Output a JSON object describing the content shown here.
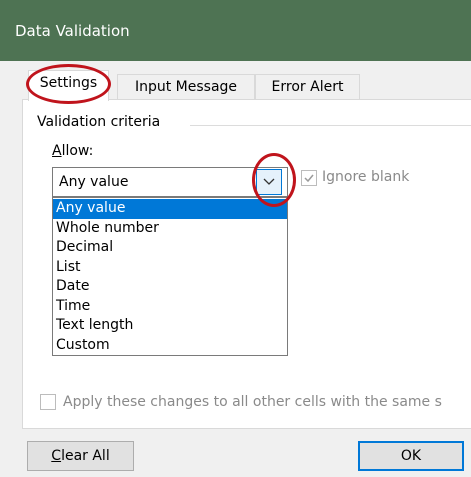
{
  "window": {
    "title": "Data Validation"
  },
  "tabs": [
    {
      "label": "Settings",
      "active": true
    },
    {
      "label": "Input Message",
      "active": false
    },
    {
      "label": "Error Alert",
      "active": false
    }
  ],
  "settings": {
    "group_label": "Validation criteria",
    "allow_label_accel": "A",
    "allow_label_rest": "llow:",
    "allow_value": "Any value",
    "ignore_blank_label": "Ignore blank",
    "ignore_blank_checked": true,
    "ignore_blank_enabled": false,
    "allow_options": [
      "Any value",
      "Whole number",
      "Decimal",
      "List",
      "Date",
      "Time",
      "Text length",
      "Custom"
    ],
    "selected_option_index": 0,
    "apply_all_label": "Apply these changes to all other cells with the same s",
    "apply_all_checked": false
  },
  "buttons": {
    "clear_all_accel": "C",
    "clear_all_rest": "lear All",
    "ok_label": "OK"
  },
  "colors": {
    "titlebar": "#4e7353",
    "highlight_ellipse": "#c0141c",
    "selection": "#0078d7"
  }
}
